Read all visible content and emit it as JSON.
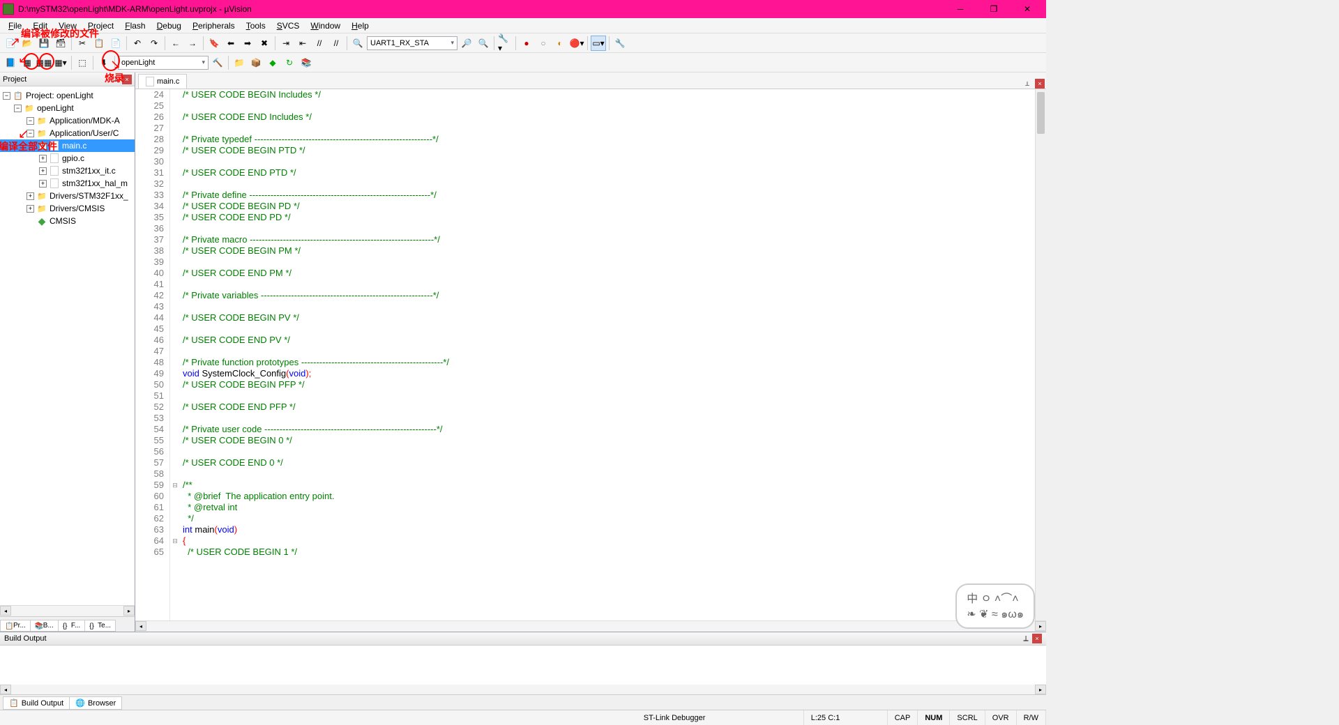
{
  "title": "D:\\mySTM32\\openLight\\MDK-ARM\\openLight.uvprojx - µVision",
  "menus": [
    "File",
    "Edit",
    "View",
    "Project",
    "Flash",
    "Debug",
    "Peripherals",
    "Tools",
    "SVCS",
    "Window",
    "Help"
  ],
  "menu_keys": [
    "F",
    "E",
    "V",
    "P",
    "F",
    "D",
    "P",
    "T",
    "S",
    "W",
    "H"
  ],
  "toolbar1": {
    "findText": "UART1_RX_STA"
  },
  "toolbar2": {
    "target": "openLight"
  },
  "annotations": {
    "a1": "编译被修改的文件",
    "a2": "烧录",
    "a3": "编译全部文件"
  },
  "project": {
    "panelTitle": "Project",
    "root": "Project: openLight",
    "target": "openLight",
    "groups": [
      {
        "name": "Application/MDK-A",
        "open": true,
        "files": []
      },
      {
        "name": "Application/User/C",
        "open": true,
        "files": [
          "main.c",
          "gpio.c",
          "stm32f1xx_it.c",
          "stm32f1xx_hal_m"
        ]
      },
      {
        "name": "Drivers/STM32F1xx_",
        "open": false,
        "files": []
      },
      {
        "name": "Drivers/CMSIS",
        "open": false,
        "files": []
      }
    ],
    "cmsis": "CMSIS",
    "selected": "main.c",
    "tabs": [
      "Pr...",
      "B...",
      "F...",
      "Te..."
    ]
  },
  "editor": {
    "tab": "main.c",
    "startLine": 24,
    "lines": [
      {
        "t": "comment",
        "s": "/* USER CODE BEGIN Includes */"
      },
      {
        "t": "",
        "s": ""
      },
      {
        "t": "comment",
        "s": "/* USER CODE END Includes */"
      },
      {
        "t": "",
        "s": ""
      },
      {
        "t": "comment",
        "s": "/* Private typedef -----------------------------------------------------------*/"
      },
      {
        "t": "comment",
        "s": "/* USER CODE BEGIN PTD */"
      },
      {
        "t": "",
        "s": ""
      },
      {
        "t": "comment",
        "s": "/* USER CODE END PTD */"
      },
      {
        "t": "",
        "s": ""
      },
      {
        "t": "comment",
        "s": "/* Private define ------------------------------------------------------------*/"
      },
      {
        "t": "comment",
        "s": "/* USER CODE BEGIN PD */"
      },
      {
        "t": "comment",
        "s": "/* USER CODE END PD */"
      },
      {
        "t": "",
        "s": ""
      },
      {
        "t": "comment",
        "s": "/* Private macro -------------------------------------------------------------*/"
      },
      {
        "t": "comment",
        "s": "/* USER CODE BEGIN PM */"
      },
      {
        "t": "",
        "s": ""
      },
      {
        "t": "comment",
        "s": "/* USER CODE END PM */"
      },
      {
        "t": "",
        "s": ""
      },
      {
        "t": "comment",
        "s": "/* Private variables ---------------------------------------------------------*/"
      },
      {
        "t": "",
        "s": ""
      },
      {
        "t": "comment",
        "s": "/* USER CODE BEGIN PV */"
      },
      {
        "t": "",
        "s": ""
      },
      {
        "t": "comment",
        "s": "/* USER CODE END PV */"
      },
      {
        "t": "",
        "s": ""
      },
      {
        "t": "comment",
        "s": "/* Private function prototypes -----------------------------------------------*/"
      },
      {
        "t": "proto",
        "s": "void SystemClock_Config(void);"
      },
      {
        "t": "comment",
        "s": "/* USER CODE BEGIN PFP */"
      },
      {
        "t": "",
        "s": ""
      },
      {
        "t": "comment",
        "s": "/* USER CODE END PFP */"
      },
      {
        "t": "",
        "s": ""
      },
      {
        "t": "comment",
        "s": "/* Private user code ---------------------------------------------------------*/"
      },
      {
        "t": "comment",
        "s": "/* USER CODE BEGIN 0 */"
      },
      {
        "t": "",
        "s": ""
      },
      {
        "t": "comment",
        "s": "/* USER CODE END 0 */"
      },
      {
        "t": "",
        "s": ""
      },
      {
        "t": "doc",
        "s": "/**",
        "fold": "-"
      },
      {
        "t": "doc",
        "s": "  * @brief  The application entry point."
      },
      {
        "t": "doc",
        "s": "  * @retval int"
      },
      {
        "t": "doc",
        "s": "  */"
      },
      {
        "t": "main",
        "s": "int main(void)"
      },
      {
        "t": "brace",
        "s": "{",
        "fold": "-"
      },
      {
        "t": "comment",
        "s": "  /* USER CODE BEGIN 1 */"
      }
    ]
  },
  "buildOutput": {
    "title": "Build Output",
    "tabs": [
      "Build Output",
      "Browser"
    ]
  },
  "status": {
    "debugger": "ST-Link Debugger",
    "pos": "L:25 C:1",
    "caps": "CAP",
    "num": "NUM",
    "scrl": "SCRL",
    "ovr": "OVR",
    "rw": "R/W"
  }
}
